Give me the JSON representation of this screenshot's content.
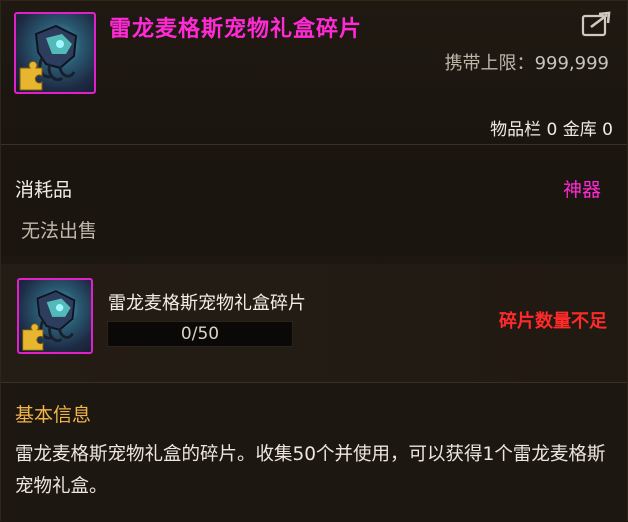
{
  "item": {
    "title": "雷龙麦格斯宠物礼盒碎片",
    "icon_name": "dragon-pet-gift-box-fragment-icon",
    "rarity_color": "#ff2ad4"
  },
  "header": {
    "carry_limit_label": "携带上限：",
    "carry_limit_value": "999,999",
    "inventory_counts": "物品栏 0 金库 0"
  },
  "category": {
    "type_label": "消耗品",
    "rarity_label": "神器",
    "sell_note": "无法出售"
  },
  "fragment": {
    "name": "雷龙麦格斯宠物礼盒碎片",
    "progress_text": "0/50",
    "progress_current": 0,
    "progress_max": 50,
    "status": "碎片数量不足",
    "status_color": "#ff2a2a"
  },
  "info": {
    "title": "基本信息",
    "description": "雷龙麦格斯宠物礼盒的碎片。收集50个并使用，可以获得1个雷龙麦格斯宠物礼盒。"
  }
}
